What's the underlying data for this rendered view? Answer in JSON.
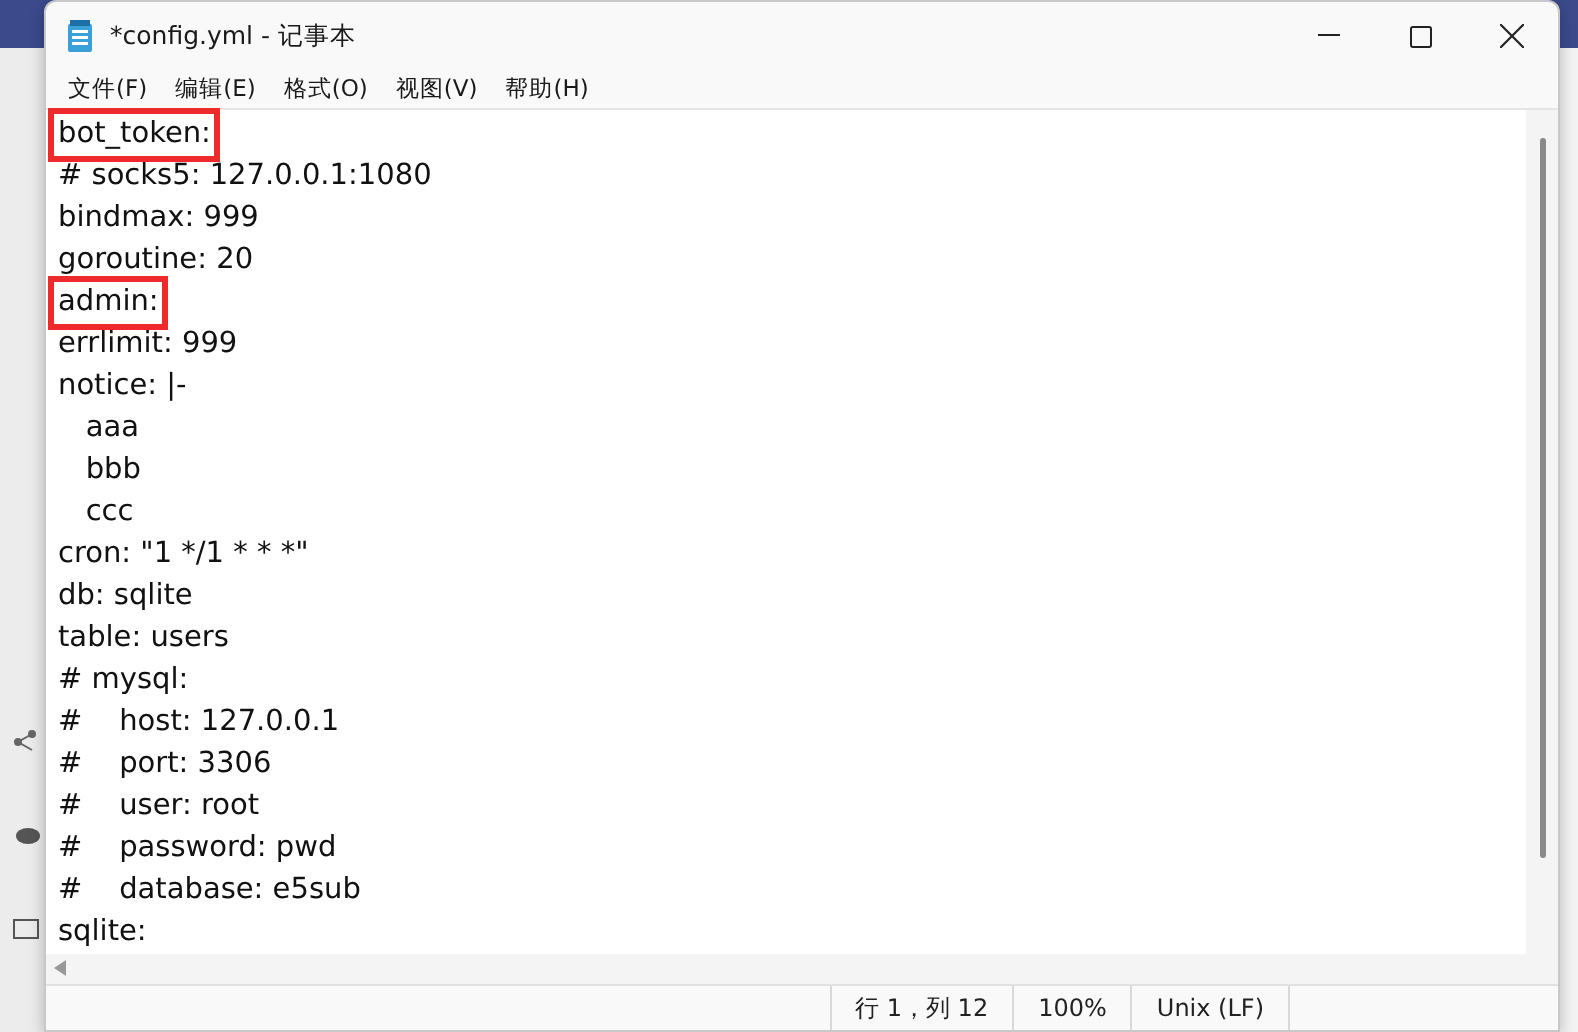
{
  "window": {
    "title": "*config.yml - 记事本"
  },
  "menu": [
    "文件(F)",
    "编辑(E)",
    "格式(O)",
    "视图(V)",
    "帮助(H)"
  ],
  "lines": [
    {
      "text": "bot_token:",
      "highlighted": true
    },
    {
      "text": "# socks5: 127.0.0.1:1080",
      "highlighted": false
    },
    {
      "text": "bindmax: 999",
      "highlighted": false
    },
    {
      "text": "goroutine: 20",
      "highlighted": false
    },
    {
      "text": "admin:",
      "highlighted": true
    },
    {
      "text": "errlimit: 999",
      "highlighted": false
    },
    {
      "text": "notice: |-",
      "highlighted": false
    },
    {
      "text": "   aaa",
      "highlighted": false
    },
    {
      "text": "   bbb",
      "highlighted": false
    },
    {
      "text": "   ccc",
      "highlighted": false
    },
    {
      "text": "cron: \"1 */1 * * *\"",
      "highlighted": false
    },
    {
      "text": "db: sqlite",
      "highlighted": false
    },
    {
      "text": "table: users",
      "highlighted": false
    },
    {
      "text": "# mysql:",
      "highlighted": false
    },
    {
      "text": "#    host: 127.0.0.1",
      "highlighted": false
    },
    {
      "text": "#    port: 3306",
      "highlighted": false
    },
    {
      "text": "#    user: root",
      "highlighted": false
    },
    {
      "text": "#    password: pwd",
      "highlighted": false
    },
    {
      "text": "#    database: e5sub",
      "highlighted": false
    },
    {
      "text": "sqlite:",
      "highlighted": false
    }
  ],
  "status_bar": {
    "position": "行 1，列 12",
    "zoom": "100%",
    "line_ending": "Unix (LF)"
  }
}
